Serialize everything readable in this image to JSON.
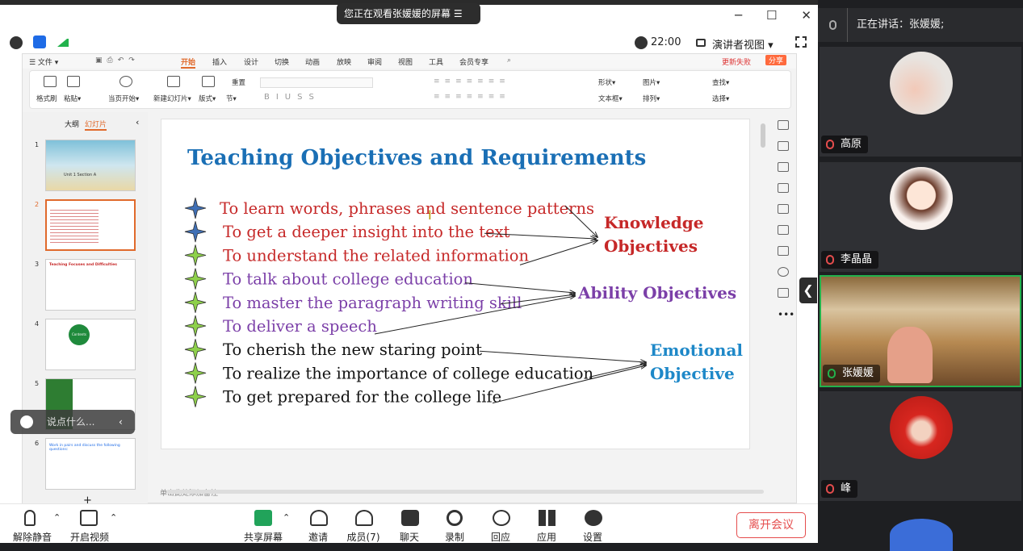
{
  "meeting": {
    "share_banner": "您正在观看张媛媛的屏幕 ☰",
    "time": "22:00",
    "view_mode": "演讲者视图 ▾"
  },
  "wps": {
    "menu": [
      "☰ 文件 ▾",
      "开始",
      "插入",
      "设计",
      "切换",
      "动画",
      "放映",
      "审阅",
      "视图",
      "工具",
      "会员专享"
    ],
    "update_label": "更新失败",
    "share_label": "分享",
    "ribbon": [
      "格式刷",
      "粘贴▾",
      "当页开始▾",
      "新建幻灯片▾",
      "版式▾",
      "节▾",
      "重置",
      "形状▾",
      "图片▾",
      "文本框▾",
      "排列▾",
      "查找▾",
      "选择▾"
    ],
    "panel_tabs": [
      "大纲",
      "幻灯片"
    ],
    "thumbs": [
      "1",
      "2",
      "3",
      "4",
      "5",
      "6"
    ],
    "thumb1_title": "Unit 1 Section A",
    "thumb3_title": "Teaching Focuses and Difficulties",
    "thumb4_label": "Contents",
    "thumb6_title": "Work in pairs and discuss the following questions:",
    "notes_hint": "单击此处添加备注",
    "add_slide": "+",
    "chat_placeholder": "说点什么..."
  },
  "slide": {
    "title": "Teaching Objectives and Requirements",
    "items": [
      {
        "text": "To learn words, phrases and sentence patterns",
        "color": "#c62828",
        "star": "blue"
      },
      {
        "text": "To get a deeper insight into the text",
        "color": "#c62828",
        "star": "blue"
      },
      {
        "text": "To understand  the related information",
        "color": "#c62828",
        "star": "green"
      },
      {
        "text": "To talk about college education",
        "color": "#7b3fa8",
        "star": "green"
      },
      {
        "text": "To master the paragraph writing skill",
        "color": "#7b3fa8",
        "star": "green"
      },
      {
        "text": "To deliver a speech",
        "color": "#7b3fa8",
        "star": "green"
      },
      {
        "text": "To cherish the new staring point",
        "color": "#111111",
        "star": "green"
      },
      {
        "text": "To realize the importance of college  education",
        "color": "#111111",
        "star": "green"
      },
      {
        "text": "To get prepared for the college life",
        "color": "#111111",
        "star": "green"
      }
    ],
    "groups": [
      {
        "lines": [
          "Knowledge",
          "Objectives"
        ],
        "color": "#c62828"
      },
      {
        "lines": [
          "Ability Objectives"
        ],
        "color": "#7b3fa8"
      },
      {
        "lines": [
          "Emotional",
          "Objective"
        ],
        "color": "#1e88c8"
      }
    ]
  },
  "bottom": {
    "buttons": [
      "解除静音",
      "开启视频",
      "共享屏幕",
      "邀请",
      "成员(7)",
      "聊天",
      "录制",
      "回应",
      "应用",
      "设置"
    ],
    "leave": "离开会议"
  },
  "side": {
    "speaking": "正在讲话：张媛媛;",
    "participants": [
      "高原",
      "李晶晶",
      "张媛媛",
      "峰"
    ]
  }
}
